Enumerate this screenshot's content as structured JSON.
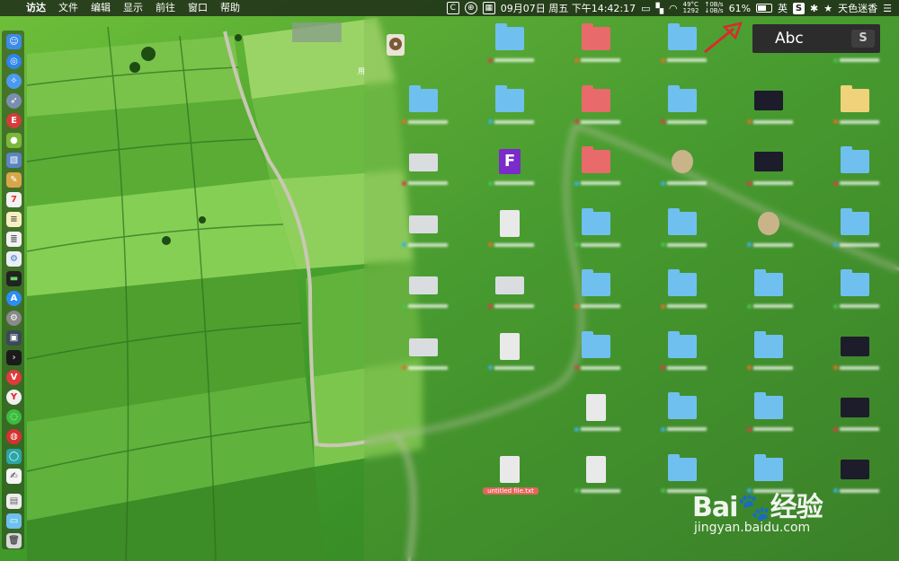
{
  "menubar": {
    "app_name": "访达",
    "menus": [
      "文件",
      "编辑",
      "显示",
      "前往",
      "窗口",
      "帮助"
    ],
    "status": {
      "datetime": "09月07日 周五 下午14:42:17",
      "temperature": "49°C",
      "fan_rpm": "1292",
      "upload": "0B/s",
      "download": "0B/s",
      "battery": "61%",
      "input_method": "英",
      "user": "天色迷香"
    }
  },
  "ime_popup": {
    "text": "Abc",
    "logo": "S"
  },
  "desktop": {
    "side_text": "用",
    "icons": [
      {
        "col": 0,
        "row": 1,
        "kind": "folder"
      },
      {
        "col": 0,
        "row": 2,
        "kind": "img"
      },
      {
        "col": 0,
        "row": 3,
        "kind": "img"
      },
      {
        "col": 0,
        "row": 4,
        "kind": "img"
      },
      {
        "col": 0,
        "row": 5,
        "kind": "img"
      },
      {
        "col": 1,
        "row": 0,
        "kind": "folder"
      },
      {
        "col": 1,
        "row": 1,
        "kind": "folder"
      },
      {
        "col": 1,
        "row": 2,
        "kind": "purple"
      },
      {
        "col": 1,
        "row": 3,
        "kind": "doc"
      },
      {
        "col": 1,
        "row": 4,
        "kind": "img"
      },
      {
        "col": 1,
        "row": 5,
        "kind": "doc"
      },
      {
        "col": 1,
        "row": 7,
        "kind": "doc",
        "label": "untitled file.txt"
      },
      {
        "col": 2,
        "row": 0,
        "kind": "red"
      },
      {
        "col": 2,
        "row": 1,
        "kind": "red"
      },
      {
        "col": 2,
        "row": 2,
        "kind": "red"
      },
      {
        "col": 2,
        "row": 3,
        "kind": "folder"
      },
      {
        "col": 2,
        "row": 4,
        "kind": "folder"
      },
      {
        "col": 2,
        "row": 5,
        "kind": "folder"
      },
      {
        "col": 2,
        "row": 6,
        "kind": "doc"
      },
      {
        "col": 2,
        "row": 7,
        "kind": "doc"
      },
      {
        "col": 3,
        "row": 0,
        "kind": "folder"
      },
      {
        "col": 3,
        "row": 1,
        "kind": "folder"
      },
      {
        "col": 3,
        "row": 2,
        "kind": "app"
      },
      {
        "col": 3,
        "row": 3,
        "kind": "folder"
      },
      {
        "col": 3,
        "row": 4,
        "kind": "folder"
      },
      {
        "col": 3,
        "row": 5,
        "kind": "folder"
      },
      {
        "col": 3,
        "row": 6,
        "kind": "folder"
      },
      {
        "col": 3,
        "row": 7,
        "kind": "folder"
      },
      {
        "col": 4,
        "row": 1,
        "kind": "dark"
      },
      {
        "col": 4,
        "row": 2,
        "kind": "dark"
      },
      {
        "col": 4,
        "row": 3,
        "kind": "app"
      },
      {
        "col": 4,
        "row": 4,
        "kind": "folder"
      },
      {
        "col": 4,
        "row": 5,
        "kind": "folder"
      },
      {
        "col": 4,
        "row": 6,
        "kind": "folder"
      },
      {
        "col": 4,
        "row": 7,
        "kind": "folder"
      },
      {
        "col": 5,
        "row": 0,
        "kind": "dark"
      },
      {
        "col": 5,
        "row": 1,
        "kind": "yellow"
      },
      {
        "col": 5,
        "row": 2,
        "kind": "folder"
      },
      {
        "col": 5,
        "row": 3,
        "kind": "folder"
      },
      {
        "col": 5,
        "row": 4,
        "kind": "folder"
      },
      {
        "col": 5,
        "row": 5,
        "kind": "dark"
      },
      {
        "col": 5,
        "row": 6,
        "kind": "dark"
      },
      {
        "col": 5,
        "row": 7,
        "kind": "dark"
      }
    ]
  },
  "watermark": {
    "brand": "Bai",
    "brand_suffix": "经验",
    "url": "jingyan.baidu.com"
  }
}
